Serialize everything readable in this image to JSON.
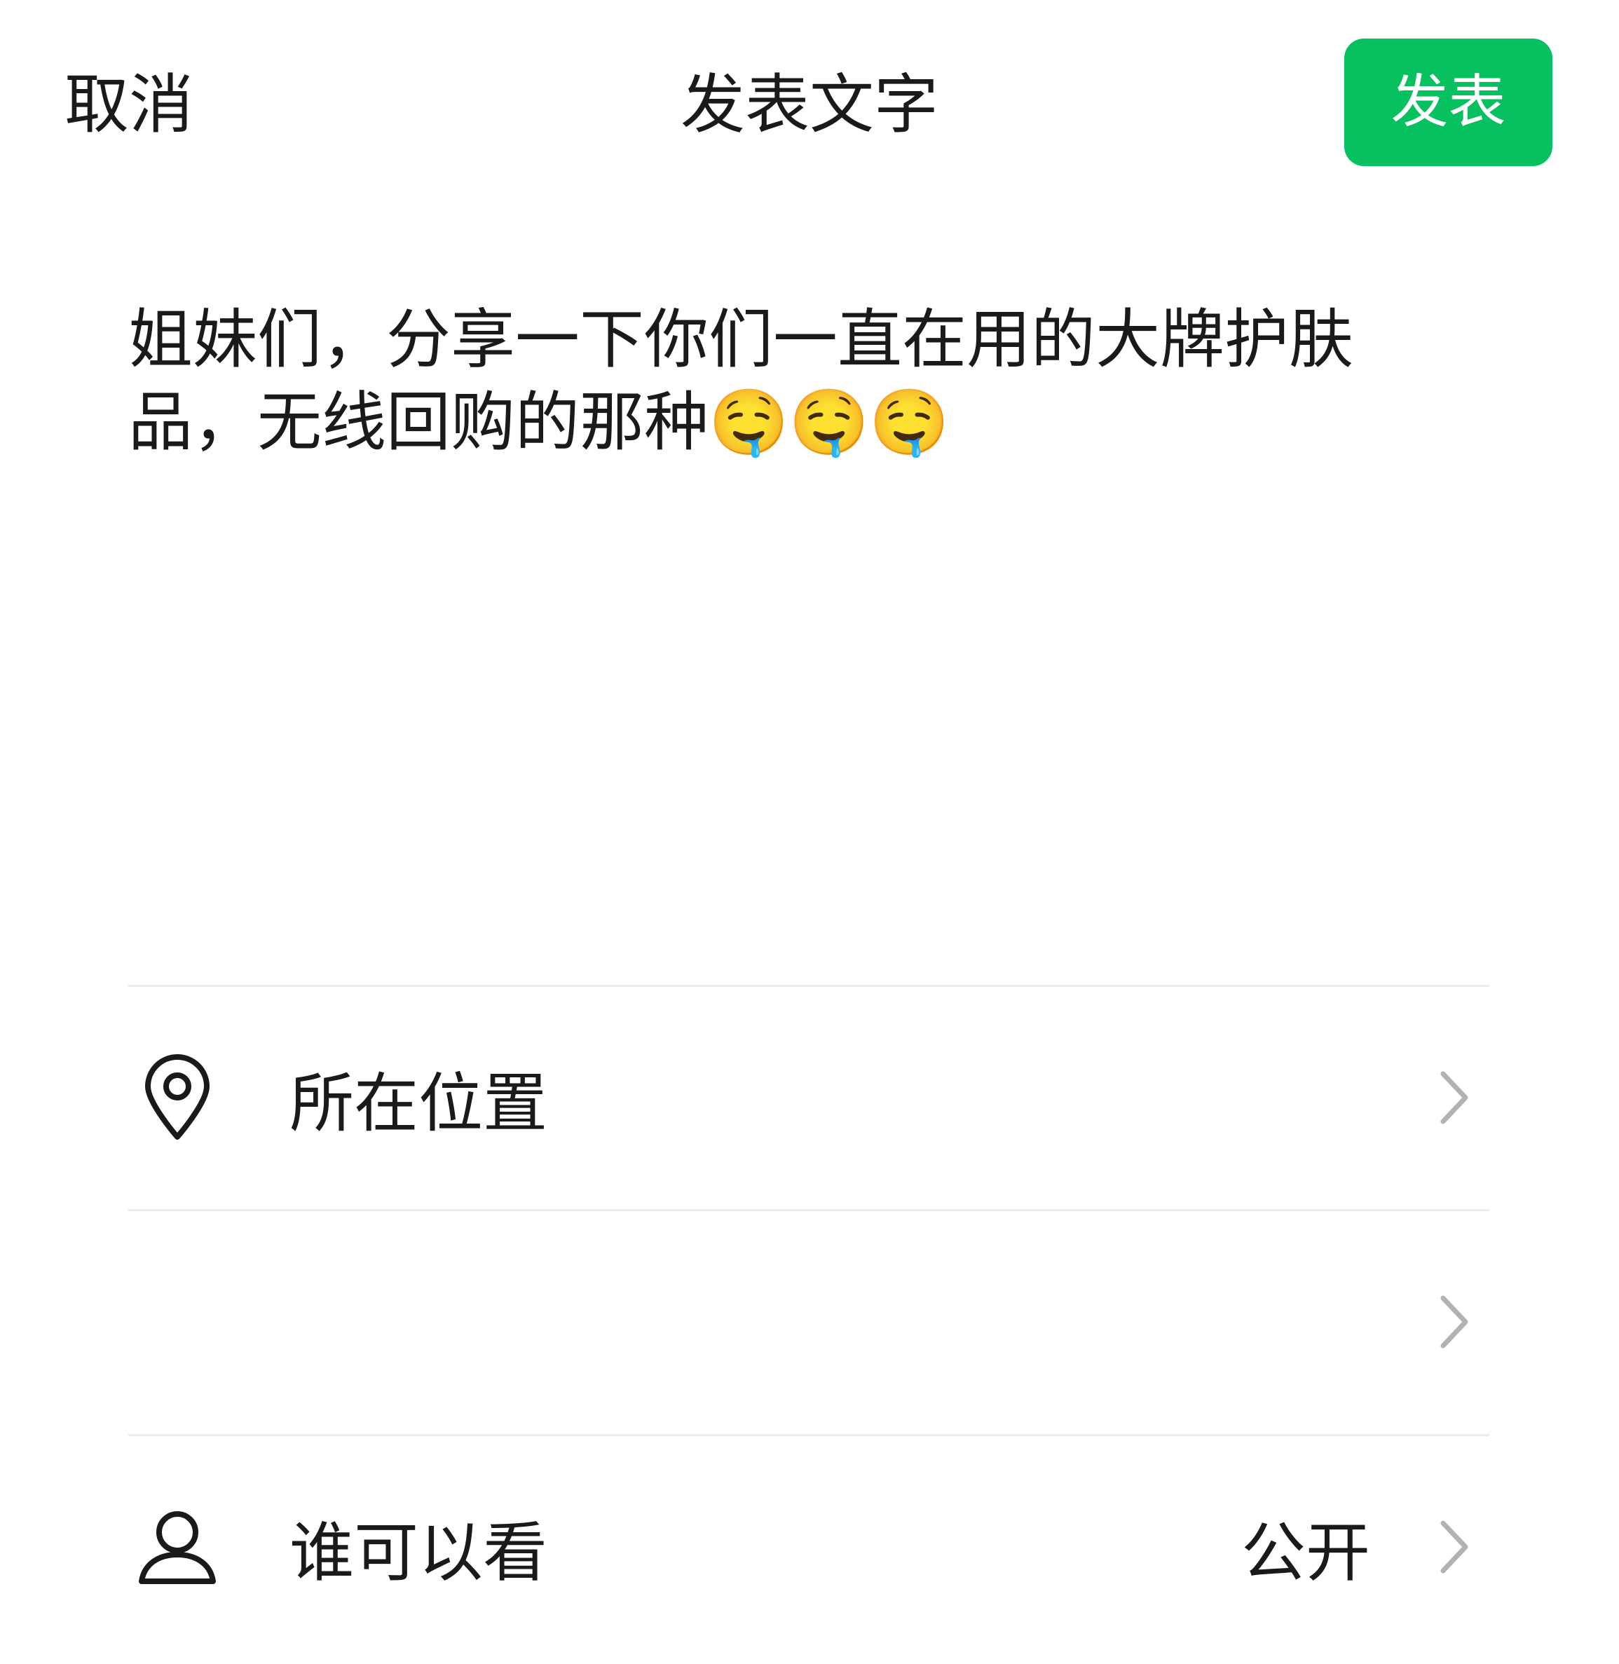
{
  "header": {
    "cancel_label": "取消",
    "title": "发表文字",
    "publish_label": "发表"
  },
  "post": {
    "text": "姐妹们，分享一下你们一直在用的大牌护肤品，无线回购的那种🤤🤤🤤"
  },
  "options": {
    "location": {
      "label": "所在位置",
      "icon": "location-pin-icon"
    },
    "blank_row": {
      "label": ""
    },
    "visibility": {
      "label": "谁可以看",
      "value": "公开",
      "icon": "person-icon"
    }
  },
  "colors": {
    "accent": "#07c160",
    "text": "#1a1a1a",
    "divider": "#ececec",
    "chevron": "#b2b2b2"
  }
}
